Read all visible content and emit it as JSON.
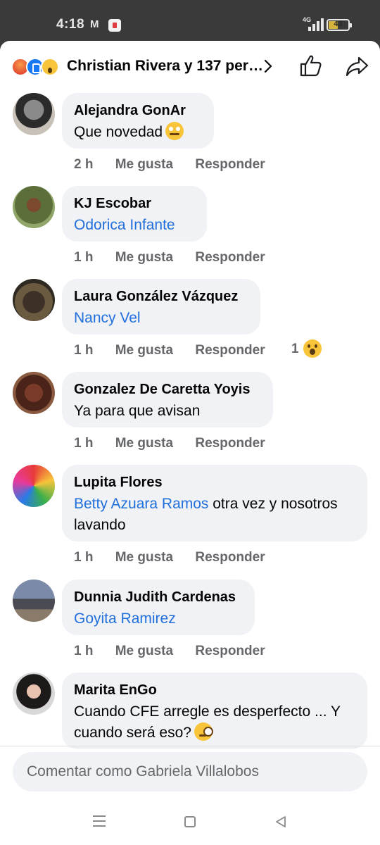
{
  "status_bar": {
    "time": "4:18",
    "gmail_icon": "M",
    "network": "4G",
    "battery": "43",
    "battery_level": 0.43
  },
  "header": {
    "reaction_icons": [
      "angry-reaction-icon",
      "like-reaction-icon",
      "wow-reaction-icon"
    ],
    "summary": "Christian Rivera y 137 per…",
    "like_icon": "thumbs-up-outline-icon",
    "share_icon": "share-arrow-icon"
  },
  "actions": {
    "like": "Me gusta",
    "reply": "Responder"
  },
  "comments": [
    {
      "name": "Alejandra GonAr",
      "text": "Que novedad",
      "emoji": "face-with-rolling-eyes",
      "time": "2 h"
    },
    {
      "name": "KJ Escobar",
      "mention": "Odorica Infante",
      "time": "1 h"
    },
    {
      "name": "Laura González Vázquez",
      "mention": "Nancy Vel",
      "time": "1 h",
      "reaction_count": "1",
      "reaction": "wow"
    },
    {
      "name": "Gonzalez De Caretta Yoyis",
      "text": "Ya para que avisan",
      "time": "1 h"
    },
    {
      "name": "Lupita Flores",
      "mention": "Betty Azuara Ramos",
      "text_after_mention": " otra vez y nosotros lavando",
      "time": "1 h"
    },
    {
      "name": "Dunnia Judith Cardenas",
      "mention": "Goyita Ramirez",
      "time": "1 h"
    },
    {
      "name": "Marita EnGo",
      "text": "Cuando CFE arregle es desperfecto ... Y cuando será eso?",
      "emoji": "face-with-monocle"
    }
  ],
  "composer": {
    "placeholder": "Comentar como Gabriela Villalobos"
  },
  "colors": {
    "mention": "#216fdb",
    "bubble": "#f0f2f5",
    "meta": "#65676b",
    "like_blue": "#1877f2"
  }
}
